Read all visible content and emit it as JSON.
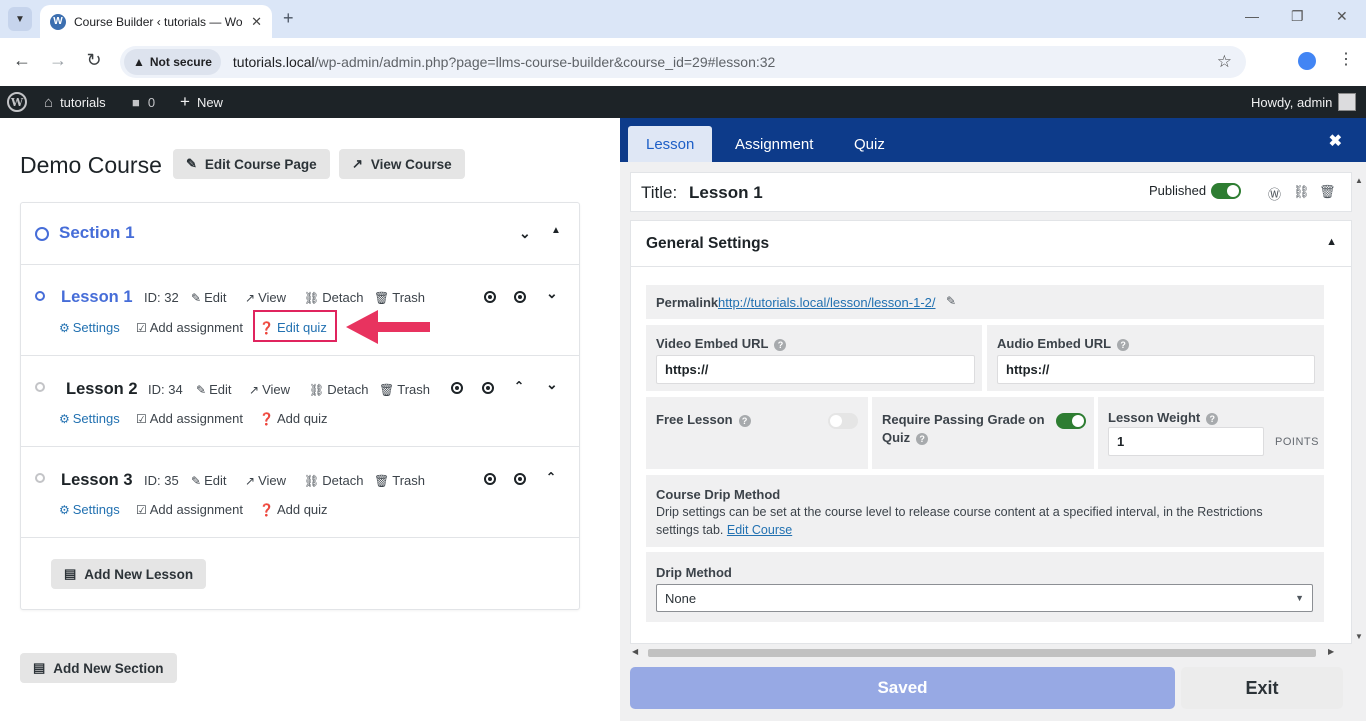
{
  "browser": {
    "tab_title": "Course Builder ‹ tutorials — Wo",
    "not_secure": "Not secure",
    "url_host": "tutorials.local",
    "url_path": "/wp-admin/admin.php?page=llms-course-builder&course_id=29#lesson:32"
  },
  "adminbar": {
    "site_name": "tutorials",
    "comments_count": "0",
    "new_label": "New",
    "howdy": "Howdy, admin"
  },
  "course": {
    "title": "Demo Course",
    "edit_page_btn": "Edit Course Page",
    "view_btn": "View Course",
    "add_lesson_btn": "Add New Lesson",
    "add_section_btn": "Add New Section",
    "section": {
      "title": "Section 1"
    },
    "lessons": [
      {
        "title": "Lesson 1",
        "id": "ID: 32",
        "edit": "Edit",
        "view": "View",
        "detach": "Detach",
        "trash": "Trash",
        "settings": "Settings",
        "assignment": "Add assignment",
        "quiz": "Edit quiz"
      },
      {
        "title": "Lesson 2",
        "id": "ID: 34",
        "edit": "Edit",
        "view": "View",
        "detach": "Detach",
        "trash": "Trash",
        "settings": "Settings",
        "assignment": "Add assignment",
        "quiz": "Add quiz"
      },
      {
        "title": "Lesson 3",
        "id": "ID: 35",
        "edit": "Edit",
        "view": "View",
        "detach": "Detach",
        "trash": "Trash",
        "settings": "Settings",
        "assignment": "Add assignment",
        "quiz": "Add quiz"
      }
    ]
  },
  "editor": {
    "tabs": [
      "Lesson",
      "Assignment",
      "Quiz"
    ],
    "title_label": "Title:",
    "title_value": "Lesson 1",
    "published_label": "Published",
    "general_settings": "General Settings",
    "permalink_label": "Permalink",
    "permalink_url": "http://tutorials.local/lesson/lesson-1-2/",
    "video_label": "Video Embed URL",
    "video_value": "https://",
    "audio_label": "Audio Embed URL",
    "audio_value": "https://",
    "free_lesson_label": "Free Lesson",
    "require_grade_label_1": "Require Passing Grade on",
    "require_grade_label_2": "Quiz",
    "weight_label": "Lesson Weight",
    "weight_value": "1",
    "points_label": "POINTS",
    "drip_heading": "Course Drip Method",
    "drip_desc": "Drip settings can be set at the course level to release course content at a specified interval, in the Restrictions",
    "drip_desc_2": "settings tab.",
    "drip_link": "Edit Course",
    "drip_method_label": "Drip Method",
    "drip_method_value": "None",
    "saved_btn": "Saved",
    "exit_btn": "Exit"
  }
}
